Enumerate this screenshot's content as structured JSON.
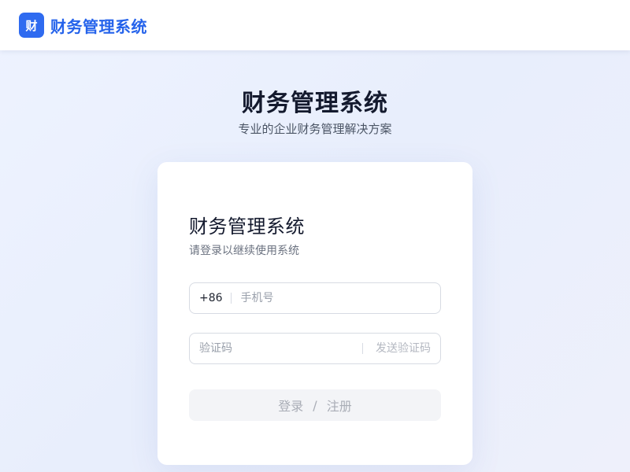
{
  "header": {
    "logo_char": "财",
    "brand": "财务管理系统"
  },
  "hero": {
    "title": "财务管理系统",
    "subtitle": "专业的企业财务管理解决方案"
  },
  "login": {
    "title": "财务管理系统",
    "subtitle": "请登录以继续使用系统",
    "phone": {
      "prefix": "+86",
      "placeholder": "手机号",
      "value": ""
    },
    "code": {
      "placeholder": "验证码",
      "value": "",
      "send_label": "发送验证码"
    },
    "submit": {
      "login_label": "登录",
      "separator": "/",
      "register_label": "注册"
    }
  },
  "colors": {
    "accent": "#2563eb",
    "logo_bg": "#2f6bf0",
    "title_text": "#141a2e",
    "disabled_button_bg": "#f3f4f7"
  }
}
